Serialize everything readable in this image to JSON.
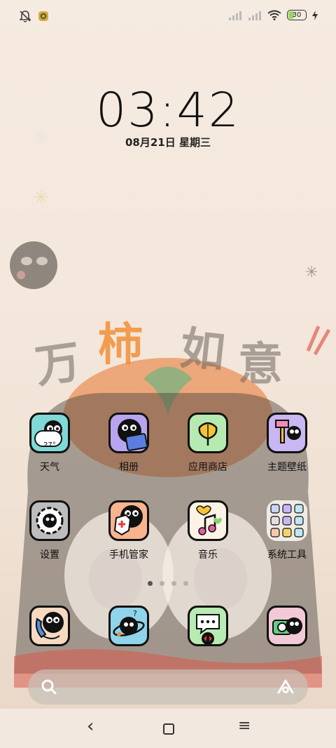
{
  "status_bar": {
    "battery_level": "30",
    "left_icons": [
      "bell-muted-icon",
      "app-notification-icon"
    ],
    "right_icons": [
      "signal-icon",
      "signal-icon",
      "wifi-icon",
      "battery-icon",
      "charging-icon"
    ]
  },
  "clock": {
    "time": "03:42",
    "date": "08月21日  星期三"
  },
  "wallpaper": {
    "text": [
      "万",
      "柿",
      "如",
      "意"
    ]
  },
  "apps_row1": [
    {
      "label": "天气",
      "badge": "27°",
      "icon": "weather-icon",
      "bg": "#7fd9d6"
    },
    {
      "label": "相册",
      "icon": "gallery-icon",
      "bg": "#b9a4f0"
    },
    {
      "label": "应用商店",
      "icon": "app-store-icon",
      "bg": "#b7eab0"
    },
    {
      "label": "主题壁纸",
      "icon": "themes-icon",
      "bg": "#c8b7f2"
    }
  ],
  "apps_row2": [
    {
      "label": "设置",
      "icon": "settings-icon",
      "bg": "#bdbdbd"
    },
    {
      "label": "手机管家",
      "icon": "security-icon",
      "bg": "#f7b48e"
    },
    {
      "label": "音乐",
      "icon": "music-icon",
      "bg": "#fbf3e6"
    },
    {
      "label": "系统工具",
      "icon": "folder-icon",
      "bg": "#f1ebe5"
    }
  ],
  "dock": [
    {
      "icon": "phone-icon",
      "bg": "#f6d9c1"
    },
    {
      "icon": "browser-icon",
      "bg": "#8fd4ea"
    },
    {
      "icon": "messages-icon",
      "bg": "#b8eab4"
    },
    {
      "icon": "camera-icon",
      "bg": "#f2c9d6"
    }
  ],
  "page_indicator": {
    "pages": 4,
    "active": 1
  },
  "search_bar": {
    "left_icon": "search-icon",
    "right_icon": "assistant-icon"
  },
  "nav_bar": {
    "back": "‹",
    "home": "□",
    "menu": "≡"
  }
}
